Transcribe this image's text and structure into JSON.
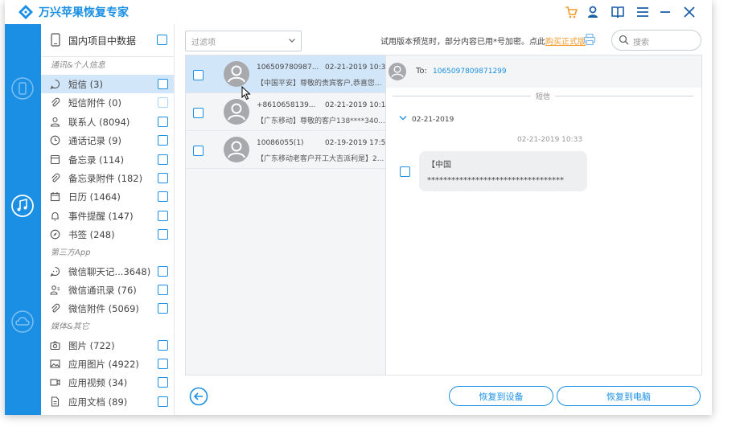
{
  "app": {
    "title": "万兴苹果恢复专家"
  },
  "colors": {
    "accent": "#1a8fe3",
    "link": "#f39a2b",
    "selected_bg": "#d2e6fa",
    "rail_bg": "#1a8fe3"
  },
  "titlebar_icons": [
    "cart-icon",
    "user-icon",
    "book-icon",
    "menu-icon",
    "minimize-icon",
    "close-icon"
  ],
  "rail": [
    {
      "name": "rail-device-recovery",
      "icon": "phone-restore-icon"
    },
    {
      "name": "rail-itunes-recovery",
      "icon": "music-restore-icon"
    },
    {
      "name": "rail-icloud-recovery",
      "icon": "cloud-restore-icon"
    }
  ],
  "sidebar": {
    "header": "国内项目中数据",
    "group1": "通讯&个人信息",
    "group2": "第三方App",
    "group3": "媒体&其它",
    "items": [
      {
        "label": "短信 (3)",
        "icon": "chat-bubble-icon"
      },
      {
        "label": "短信附件 (0)",
        "icon": "paperclip-icon"
      },
      {
        "label": "联系人 (8094)",
        "icon": "person-icon"
      },
      {
        "label": "通话记录 (9)",
        "icon": "clock-icon"
      },
      {
        "label": "备忘录 (114)",
        "icon": "note-icon"
      },
      {
        "label": "备忘录附件 (182)",
        "icon": "paperclip-icon"
      },
      {
        "label": "日历 (1464)",
        "icon": "calendar-icon"
      },
      {
        "label": "事件提醒 (147)",
        "icon": "bell-icon"
      },
      {
        "label": "书签 (248)",
        "icon": "compass-icon"
      },
      {
        "label": "微信聊天记...3648)",
        "icon": "wechat-chat-icon"
      },
      {
        "label": "微信通讯录 (76)",
        "icon": "contacts-icon"
      },
      {
        "label": "微信附件 (5069)",
        "icon": "paperclip-icon"
      },
      {
        "label": "图片 (722)",
        "icon": "camera-icon"
      },
      {
        "label": "应用图片 (4922)",
        "icon": "image-icon"
      },
      {
        "label": "应用视频 (34)",
        "icon": "video-icon"
      },
      {
        "label": "应用文档 (89)",
        "icon": "document-icon"
      }
    ]
  },
  "toolbar": {
    "filter_placeholder": "过滤项",
    "trial_text": "试用版本预览时，部分内容已用*号加密。点此",
    "trial_link": "购买正式版",
    "search_placeholder": "搜索"
  },
  "messages": [
    {
      "number": "106509780987...",
      "date": "02-21-2019 10:33",
      "preview": "【中国平安】尊敬的贵宾客户,恭喜您..."
    },
    {
      "number": "+8610658139...",
      "date": "02-21-2019 10:14",
      "preview": "【广东移动】尊敬的客户138****340..."
    },
    {
      "number": "10086055(1)",
      "date": "02-19-2019 17:50",
      "preview": "【广东移动老客户开工大吉派利是】2..."
    }
  ],
  "detail": {
    "to_label": "To:",
    "to_number": "1065097809871299",
    "section_label": "短信",
    "group_date": "02-21-2019",
    "bubble_time": "02-21-2019 10:33",
    "bubble_line1": "【中国**********************************",
    "bubble_line2": "**********************************"
  },
  "footer": {
    "restore_device": "恢复到设备",
    "restore_pc": "恢复到电脑"
  }
}
